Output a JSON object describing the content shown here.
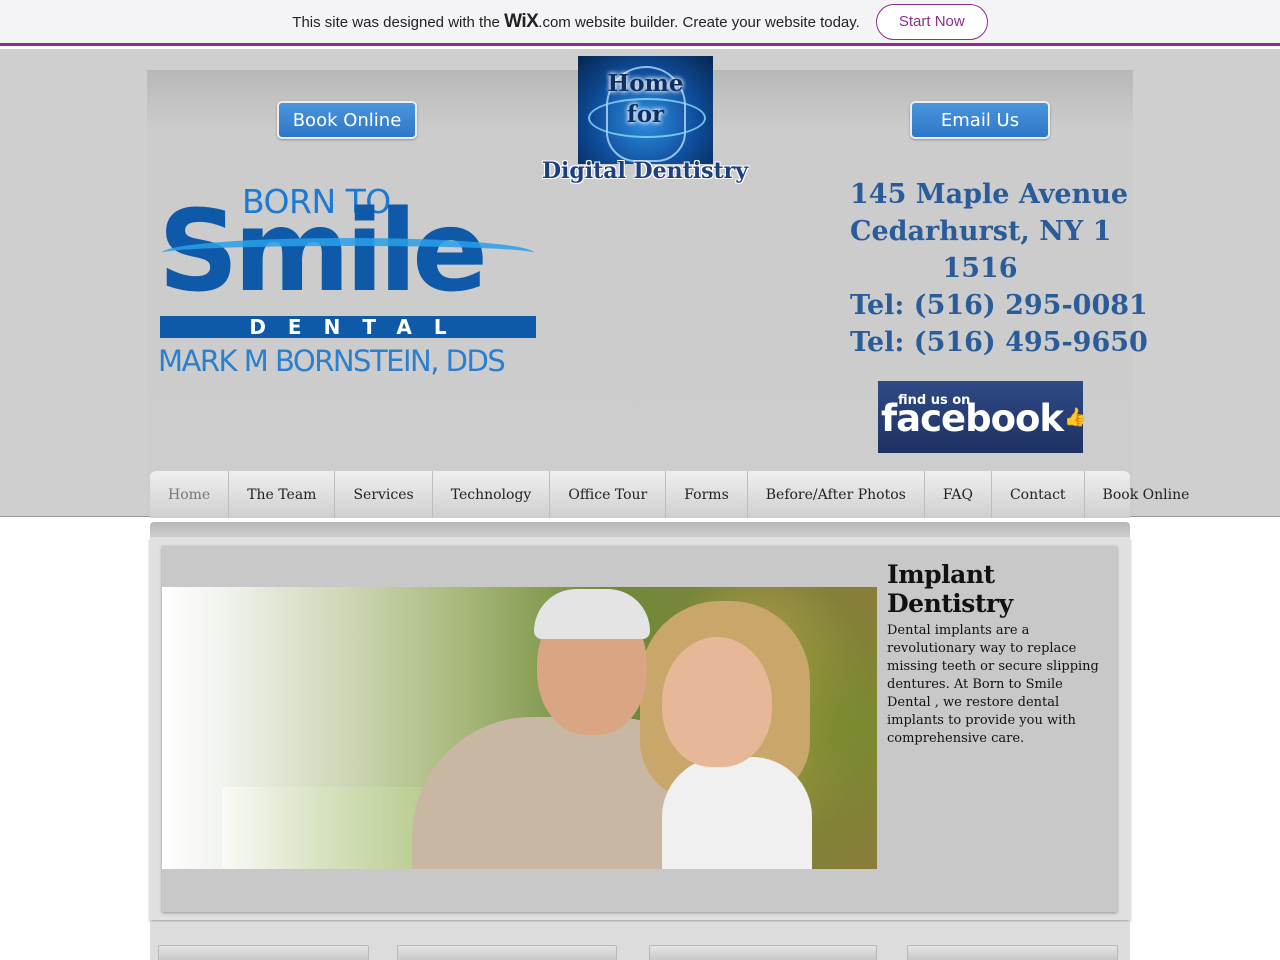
{
  "wix_banner": {
    "text_before": "This site was designed with the",
    "logo_text": "WiX",
    "text_after": ".com website builder. Create your website today.",
    "cta": "Start Now"
  },
  "header": {
    "book_online": "Book Online",
    "email_us": "Email Us",
    "home_label_line1": "Home",
    "home_label_line2": "for",
    "digital_dentistry": "Digital Dentistry",
    "logo": {
      "born_to": "BORN TO",
      "smile": "Smile",
      "dental": "DENTAL",
      "doctor": "MARK M BORNSTEIN, DDS"
    },
    "address": {
      "line1": "145 Maple Avenue",
      "line2": "Cedarhurst, NY 1",
      "line3": "1516",
      "tel1": "Tel: (516) 295-0081",
      "tel2": "Tel: (516) 495-9650"
    },
    "facebook": {
      "small": "find us on",
      "big": "facebook"
    }
  },
  "nav": {
    "items": [
      {
        "label": "Home"
      },
      {
        "label": "The Team"
      },
      {
        "label": "Services"
      },
      {
        "label": "Technology"
      },
      {
        "label": "Office Tour"
      },
      {
        "label": "Forms"
      },
      {
        "label": "Before/After Photos"
      },
      {
        "label": "FAQ"
      },
      {
        "label": "Contact"
      },
      {
        "label": "Book Online"
      }
    ],
    "active": "Home"
  },
  "main": {
    "heading": "Implant Dentistry",
    "body": "Dental implants are a revolutionary way to replace missing teeth or secure slipping dentures. At Born to Smile Dental , we restore dental implants to provide you with comprehensive care."
  },
  "colors": {
    "wix_accent": "#8b2f8f",
    "button_blue": "#2f78c6",
    "address_blue": "#2b5c9a",
    "logo_blue": "#0f5aa8"
  }
}
